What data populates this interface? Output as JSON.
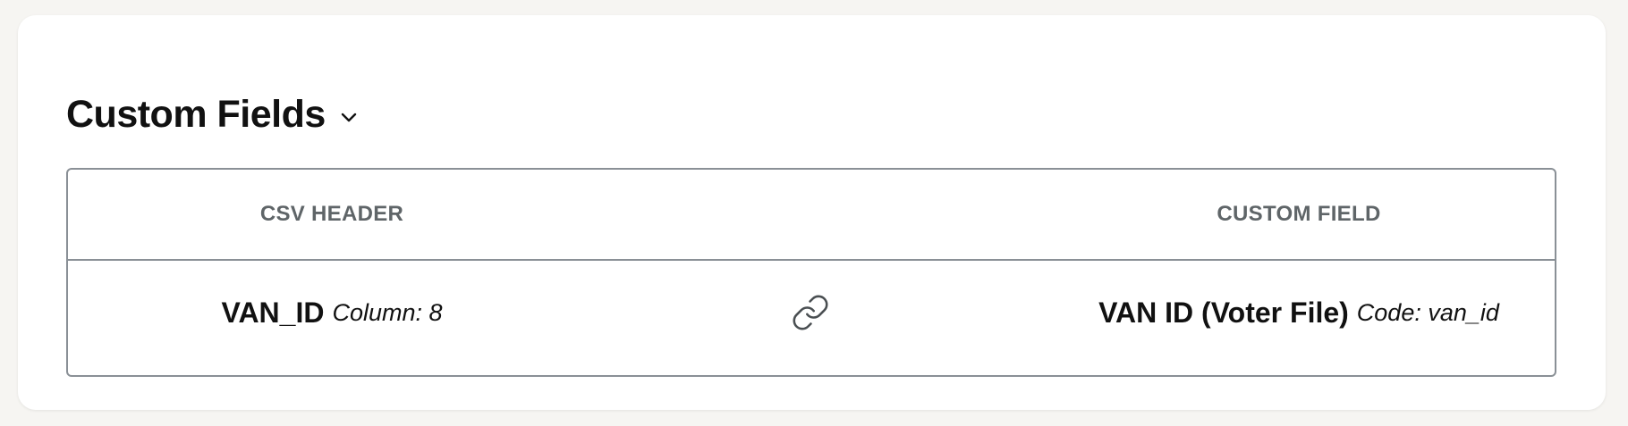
{
  "section": {
    "title": "Custom Fields"
  },
  "table": {
    "headers": {
      "left": "CSV HEADER",
      "right": "CUSTOM FIELD"
    },
    "rows": [
      {
        "csv_header": "VAN_ID",
        "csv_column": "Column: 8",
        "custom_field": "VAN ID (Voter File)",
        "custom_code": "Code: van_id"
      }
    ]
  },
  "icons": {
    "toggle": "chevron-down-icon",
    "mapping": "link-icon"
  },
  "colors": {
    "page_background": "#f6f5f2",
    "card_background": "#ffffff",
    "border": "#8a9096",
    "header_text": "#5f6568",
    "text": "#111111"
  }
}
